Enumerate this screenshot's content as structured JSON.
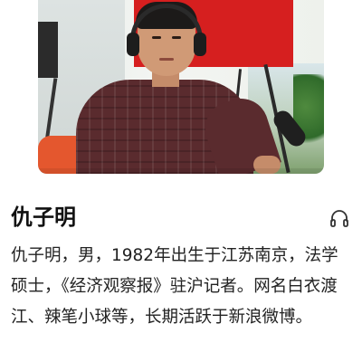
{
  "profile": {
    "name": "仇子明",
    "bio": "仇子明，男，1982年出生于江苏南京，法学硕士，《经济观察报》驻沪记者。网名白衣渡江、辣笔小球等，长期活跃于新浪微博。"
  },
  "icons": {
    "audio": "headphones-icon"
  },
  "colors": {
    "banner": "#d61f1f",
    "shirt": "#5a2b2e",
    "text": "#222222"
  }
}
